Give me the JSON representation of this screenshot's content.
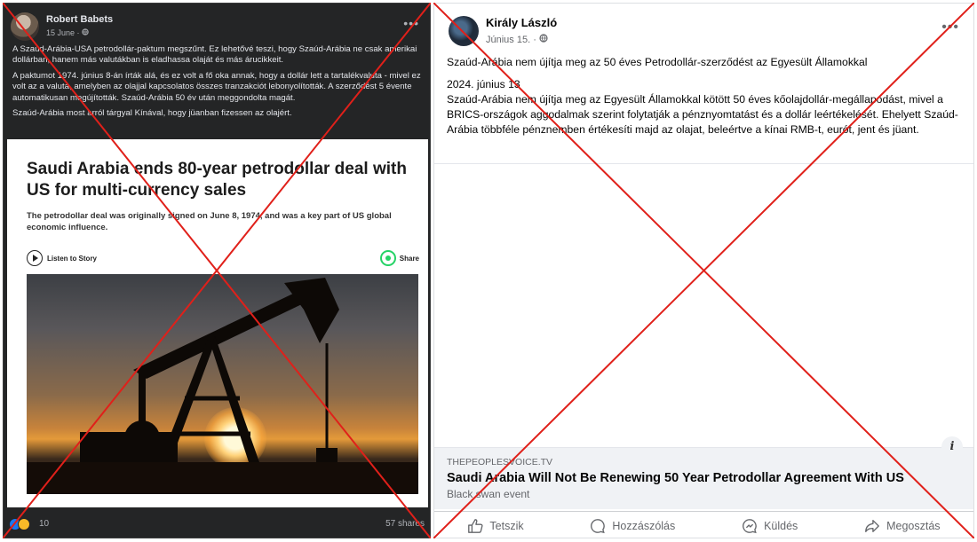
{
  "left_post": {
    "author": "Robert Babets",
    "date": "15 June",
    "privacy_icon": "globe-icon",
    "paragraphs": [
      "A Szaúd-Arábia-USA petrodollár-paktum megszűnt. Ez lehetővé teszi, hogy Szaúd-Arábia ne csak amerikai dollárban, hanem más valutákban is eladhassa olaját és más árucikkeit.",
      "A paktumot 1974. június 8-án írták alá, és ez volt a fő oka annak, hogy a dollár lett a tartalékvaluta - mivel ez volt az a valuta, amelyben az olajjal kapcsolatos összes tranzakciót lebonyolították. A szerződést 5 évente automatikusan megújították. Szaúd-Arábia 50 év után meggondolta magát.",
      "Szaúd-Arábia most arról tárgyal Kínával, hogy jüanban fizessen az olajért."
    ],
    "article": {
      "title": "Saudi Arabia ends 80-year petrodollar deal with US for multi-currency sales",
      "subtitle": "The petrodollar deal was originally signed on June 8, 1974, and was a key part of US global economic influence.",
      "listen_label": "Listen to Story",
      "share_label": "Share"
    },
    "reaction_count": "10",
    "shares": "57 shares"
  },
  "right_post": {
    "author": "Király László",
    "date": "Június 15.",
    "privacy_icon": "globe-icon",
    "lead": "Szaúd-Arábia nem újítja meg az 50 éves Petrodollár-szerződést az Egyesült Államokkal",
    "date_line": "2024. június 13",
    "body": "Szaúd-Arábia nem újítja meg az Egyesült Államokkal kötött 50 éves kőolajdollár-megállapodást, mivel a BRICS-országok aggodalmak szerint folytatják a pénznyomtatást és a dollár leértékelését. Ehelyett Szaúd-Arábia többféle pénznemben értékesíti majd az olajat, beleértve a kínai RMB-t, eurót, jent és jüant.",
    "link": {
      "domain": "THEPEOPLESVOICE.TV",
      "title": "Saudi Arabia Will Not Be Renewing 50 Year Petrodollar Agreement With US",
      "description": "Black swan event"
    },
    "actions": [
      "Tetszik",
      "Hozzászólás",
      "Küldés",
      "Megosztás"
    ]
  },
  "overlay": {
    "cross_color": "#e0201a"
  }
}
